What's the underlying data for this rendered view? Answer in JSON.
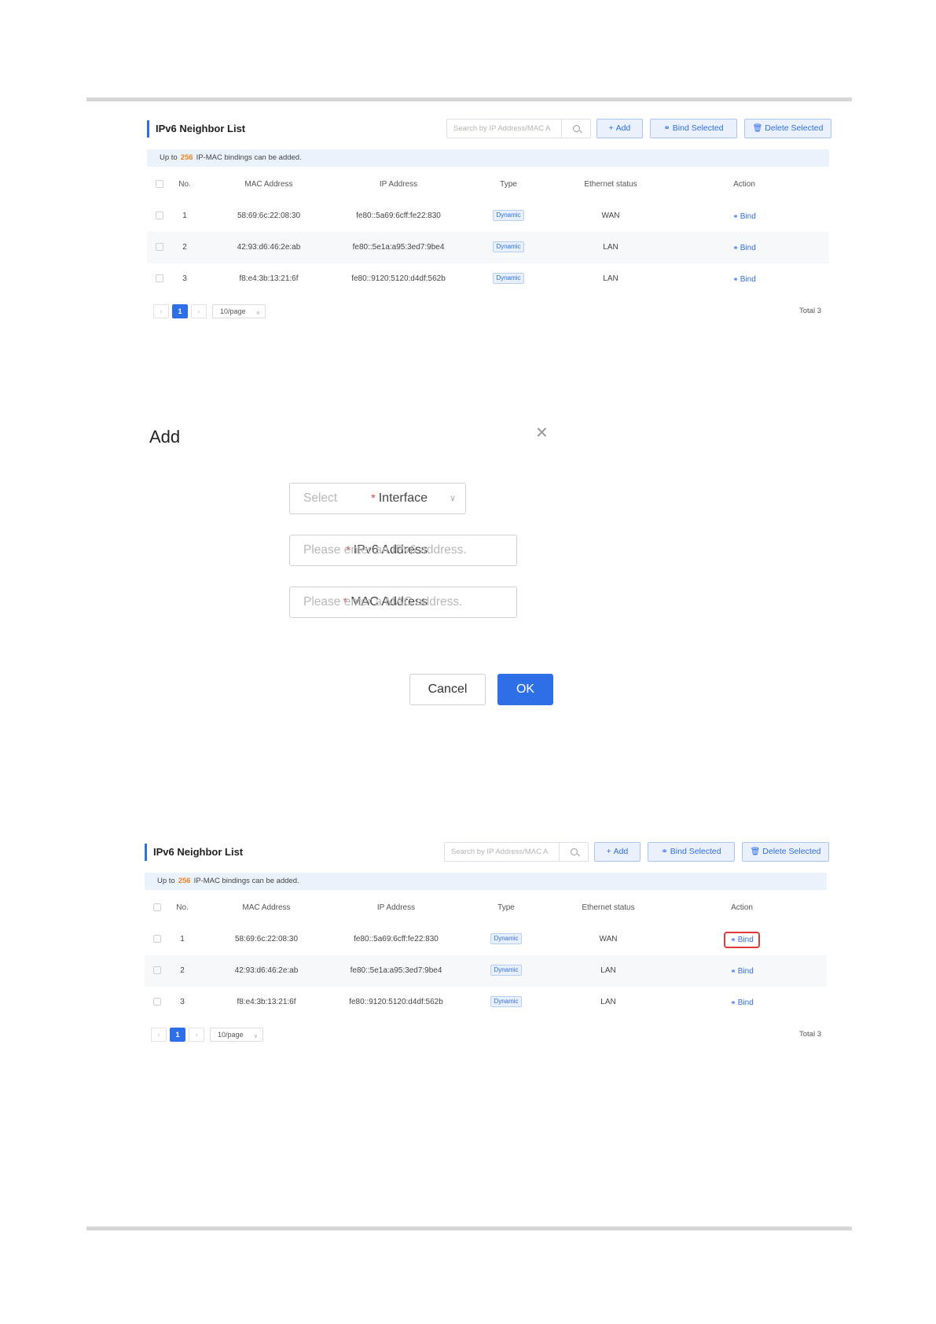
{
  "neighbor_list": {
    "title": "IPv6 Neighbor List",
    "search_placeholder": "Search by IP Address/MAC A",
    "add_label": "Add",
    "bind_selected_label": "Bind Selected",
    "delete_selected_label": "Delete Selected",
    "notice_prefix": "Up to",
    "notice_count": "256",
    "notice_suffix": "IP-MAC bindings can be added.",
    "columns": {
      "no": "No.",
      "mac": "MAC Address",
      "ip": "IP Address",
      "type": "Type",
      "eth": "Ethernet status",
      "action": "Action"
    },
    "rows": [
      {
        "no": "1",
        "mac": "58:69:6c:22:08:30",
        "ip": "fe80::5a69:6cff:fe22:830",
        "type": "Dynamic",
        "eth": "WAN",
        "action": "Bind"
      },
      {
        "no": "2",
        "mac": "42:93:d6:46:2e:ab",
        "ip": "fe80::5e1a:a95:3ed7:9be4",
        "type": "Dynamic",
        "eth": "LAN",
        "action": "Bind"
      },
      {
        "no": "3",
        "mac": "f8:e4:3b:13:21:6f",
        "ip": "fe80::9120:5120:d4df:562b",
        "type": "Dynamic",
        "eth": "LAN",
        "action": "Bind"
      }
    ],
    "pagination": {
      "current_page": "1",
      "page_size": "10/page",
      "total": "Total 3"
    }
  },
  "add_dialog": {
    "title": "Add",
    "interface_label": "Interface",
    "interface_placeholder": "Select",
    "ipv6_label": "IPv6 Address",
    "ipv6_placeholder": "Please enter an IPv6 address.",
    "mac_label": "MAC Address",
    "mac_placeholder": "Please enter a MAC address.",
    "required_mark": "*",
    "cancel_label": "Cancel",
    "ok_label": "OK"
  },
  "icons": {
    "add": "plus-icon",
    "bind": "link-icon",
    "delete": "trash-icon",
    "search": "search-icon",
    "close": "close-icon"
  },
  "colors": {
    "accent": "#2e6fe8",
    "highlight": "#e03a3a",
    "notice_number": "#f0821e"
  }
}
